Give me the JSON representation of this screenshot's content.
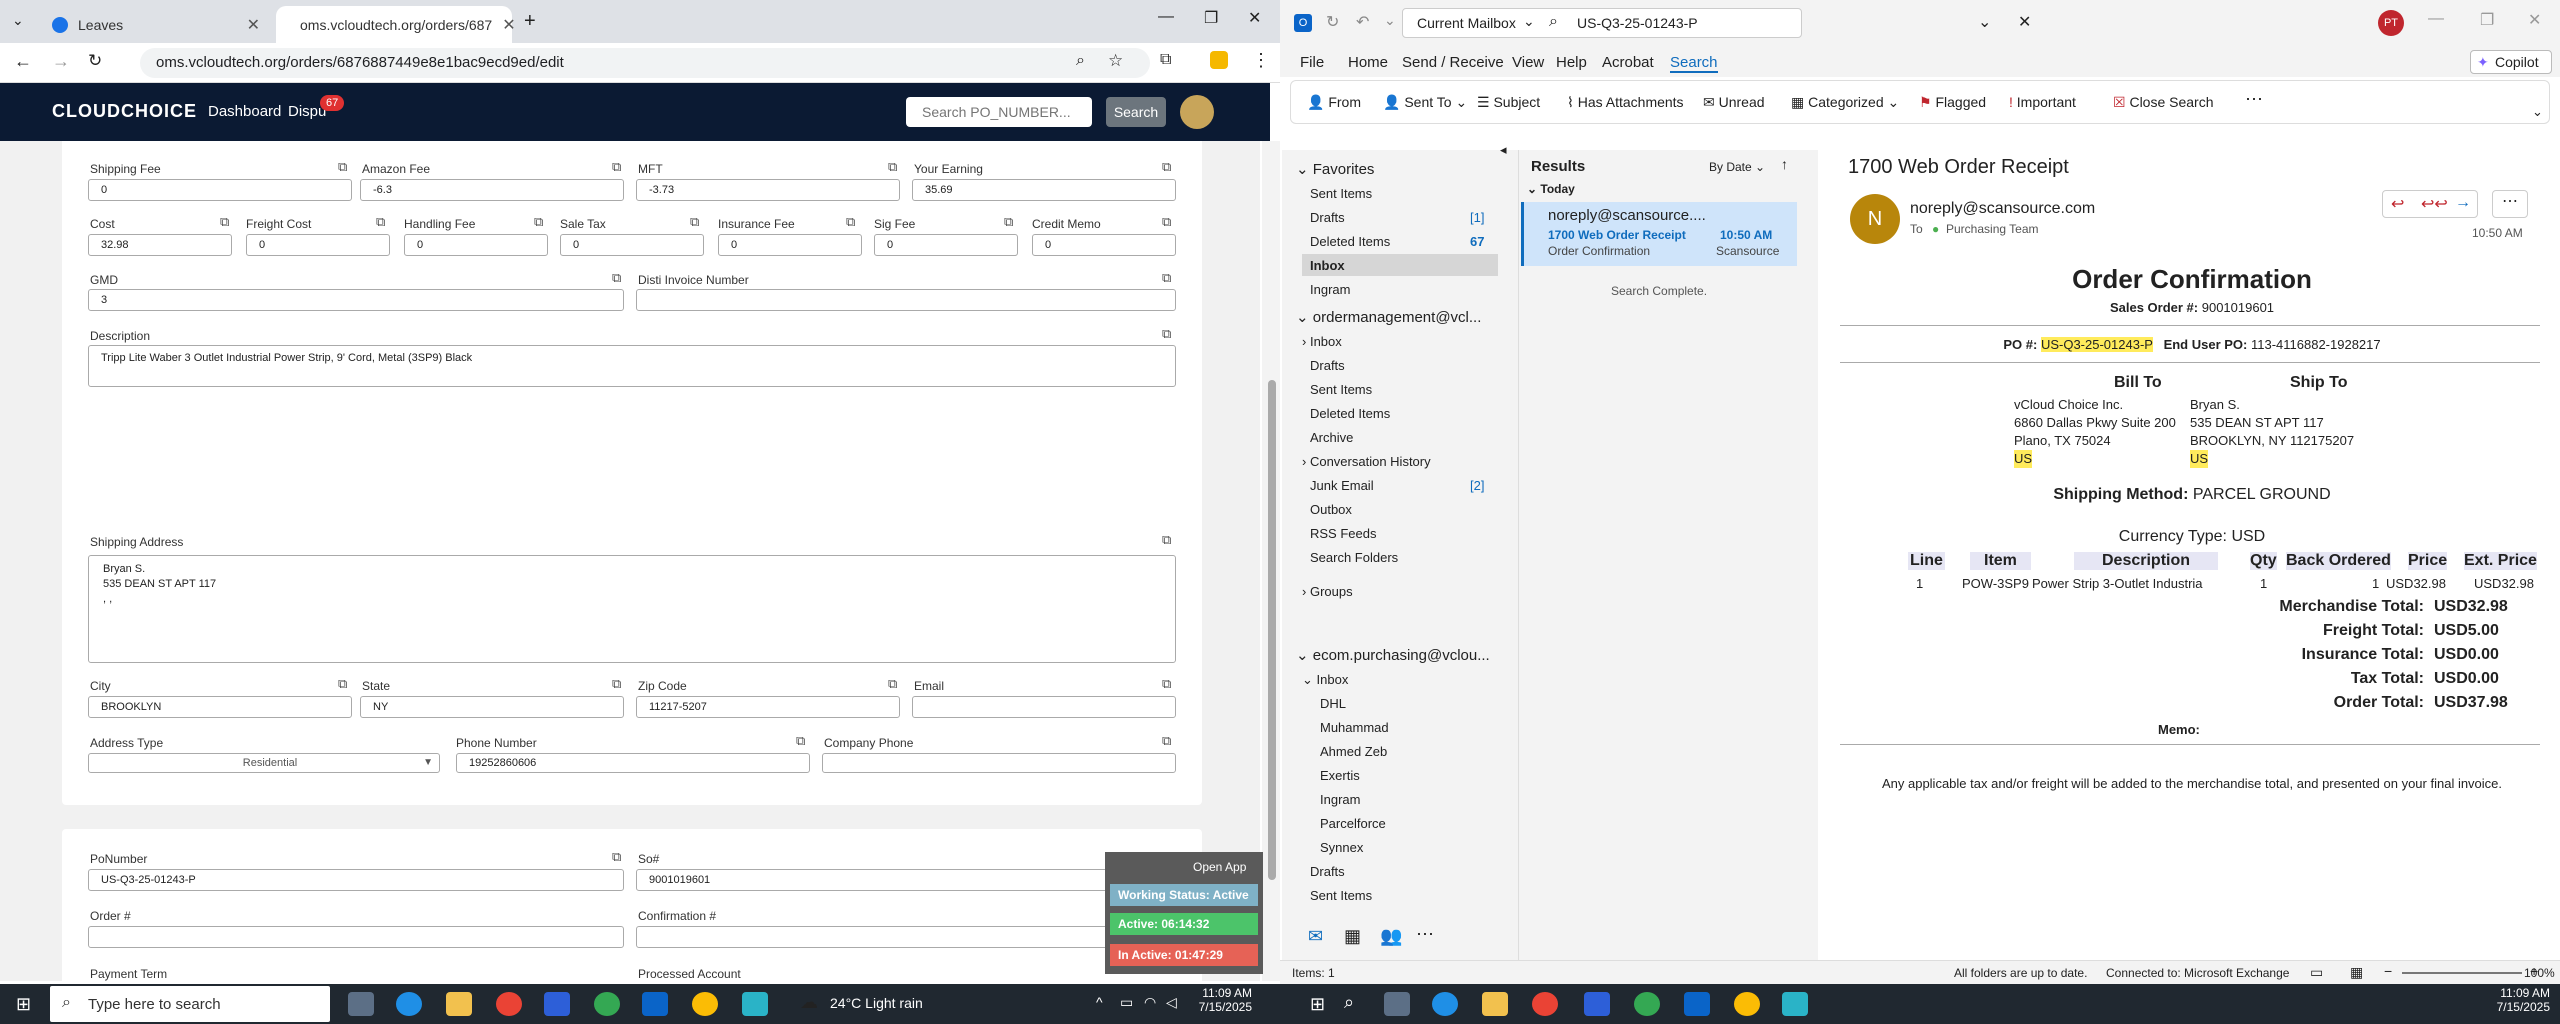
{
  "browser": {
    "tabs": [
      {
        "label": "Leaves"
      },
      {
        "label": "oms.vcloudtech.org/orders/687"
      }
    ],
    "url": "oms.vcloudtech.org/orders/6876887449e8e1bac9ecd9ed/edit"
  },
  "app": {
    "logo": "CLOUDCHOICE",
    "nav": {
      "dashboard": "Dashboard",
      "dispute": "Dispu",
      "badge": "67"
    },
    "search": {
      "placeholder": "Search PO_NUMBER...",
      "button": "Search"
    }
  },
  "form": {
    "row1": [
      {
        "label": "Shipping Fee",
        "value": "0"
      },
      {
        "label": "Amazon Fee",
        "value": "-6.3"
      },
      {
        "label": "MFT",
        "value": "-3.73"
      },
      {
        "label": "Your Earning",
        "value": "35.69"
      }
    ],
    "row2": [
      {
        "label": "Cost",
        "value": "32.98"
      },
      {
        "label": "Freight Cost",
        "value": "0"
      },
      {
        "label": "Handling Fee",
        "value": "0"
      },
      {
        "label": "Sale Tax",
        "value": "0"
      },
      {
        "label": "Insurance Fee",
        "value": "0"
      },
      {
        "label": "Sig Fee",
        "value": "0"
      },
      {
        "label": "Credit Memo",
        "value": "0"
      }
    ],
    "gmd": {
      "label": "GMD",
      "value": "3"
    },
    "disti": {
      "label": "Disti Invoice Number",
      "value": ""
    },
    "description": {
      "label": "Description",
      "value": "Tripp Lite Waber 3 Outlet Industrial Power Strip, 9' Cord, Metal (3SP9) Black"
    },
    "shipping_address": {
      "label": "Shipping Address",
      "line1": "Bryan S.",
      "line2": "535 DEAN ST APT 117",
      "line3": ", ,"
    },
    "city": {
      "label": "City",
      "value": "BROOKLYN"
    },
    "state": {
      "label": "State",
      "value": "NY"
    },
    "zip": {
      "label": "Zip Code",
      "value": "11217-5207"
    },
    "email": {
      "label": "Email",
      "value": ""
    },
    "address_type": {
      "label": "Address Type",
      "value": "Residential"
    },
    "phone": {
      "label": "Phone Number",
      "value": "19252860606"
    },
    "company_phone": {
      "label": "Company Phone",
      "value": ""
    },
    "po": {
      "label": "PoNumber",
      "value": "US-Q3-25-01243-P"
    },
    "so": {
      "label": "So#",
      "value": "9001019601"
    },
    "order": {
      "label": "Order #",
      "value": ""
    },
    "confirmation": {
      "label": "Confirmation #",
      "value": ""
    },
    "payment_term": {
      "label": "Payment Term"
    },
    "processed_account": {
      "label": "Processed Account"
    }
  },
  "widget": {
    "open_app": "Open App",
    "working": "Working Status: Active",
    "active": "Active: 06:14:32",
    "inactive": "In Active: 01:47:29"
  },
  "outlook": {
    "mailbox": "Current Mailbox",
    "search": "US-Q3-25-01243-P",
    "avatar": "PT",
    "copilot": "Copilot",
    "menu": [
      "File",
      "Home",
      "Send / Receive",
      "View",
      "Help",
      "Acrobat",
      "Search"
    ],
    "ribbon": [
      "From",
      "Sent To",
      "Subject",
      "Has Attachments",
      "Unread",
      "Categorized",
      "Flagged",
      "Important",
      "Close Search"
    ],
    "favorites": {
      "title": "Favorites",
      "items": [
        "Sent Items",
        "Drafts",
        "Deleted Items",
        "Inbox",
        "Ingram"
      ],
      "drafts_count": "[1]",
      "deleted_count": "67"
    },
    "account1": {
      "name": "ordermanagement@vcl...",
      "items": [
        "Inbox",
        "Drafts",
        "Sent Items",
        "Deleted Items",
        "Archive",
        "Conversation History",
        "Junk Email",
        "Outbox",
        "RSS Feeds",
        "Search Folders"
      ],
      "junk_count": "[2]"
    },
    "groups": "Groups",
    "account2": {
      "name": "ecom.purchasing@vclou...",
      "items": [
        "Inbox",
        "DHL",
        "Muhammad",
        "Ahmed Zeb",
        "Exertis",
        "Ingram",
        "Parcelforce",
        "Synnex",
        "Drafts",
        "Sent Items"
      ]
    },
    "results": {
      "title": "Results",
      "sort": "By Date",
      "group": "Today",
      "from": "noreply@scansource....",
      "subject": "1700 Web Order Receipt",
      "time": "10:50 AM",
      "preview": "Order Confirmation",
      "folder": "Scansource",
      "complete": "Search Complete."
    },
    "reading": {
      "subject": "1700 Web Order Receipt",
      "avatar": "N",
      "from": "noreply@scansource.com",
      "to": "To",
      "recipient": "Purchasing Team",
      "time": "10:50 AM"
    },
    "receipt": {
      "title": "Order Confirmation",
      "sales_order_label": "Sales Order #:",
      "sales_order": "9001019601",
      "po_label": "PO #:",
      "po": "US-Q3-25-01243-P",
      "enduser_label": "End User PO:",
      "enduser": "113-4116882-1928217",
      "bill_to": "Bill To",
      "ship_to": "Ship To",
      "bill": [
        "vCloud Choice Inc.",
        "6860 Dallas Pkwy Suite 200",
        "Plano, TX 75024",
        "US"
      ],
      "ship": [
        "Bryan S.",
        "535 DEAN ST APT 117",
        "BROOKLYN, NY 112175207",
        "US"
      ],
      "shipping_method_label": "Shipping Method:",
      "shipping_method": "PARCEL GROUND",
      "currency_label": "Currency Type:",
      "currency": "USD",
      "headers": [
        "Line",
        "Item",
        "Description",
        "Qty",
        "Back Ordered",
        "Price",
        "Ext. Price"
      ],
      "row": [
        "1",
        "POW-3SP9",
        "Power Strip 3-Outlet Industria",
        "1",
        "1",
        "USD32.98",
        "USD32.98"
      ],
      "totals": [
        {
          "label": "Merchandise Total:",
          "value": "USD32.98"
        },
        {
          "label": "Freight Total:",
          "value": "USD5.00"
        },
        {
          "label": "Insurance Total:",
          "value": "USD0.00"
        },
        {
          "label": "Tax Total:",
          "value": "USD0.00"
        },
        {
          "label": "Order Total:",
          "value": "USD37.98"
        }
      ],
      "memo": "Memo:",
      "footer": "Any applicable tax and/or freight will be added to the merchandise total, and presented on your final invoice."
    },
    "status": {
      "items": "Items: 1",
      "uptodate": "All folders are up to date.",
      "connected": "Connected to: Microsoft Exchange",
      "zoom": "100%"
    }
  },
  "taskbar": {
    "search": "Type here to search",
    "weather": "24°C Light rain",
    "time1": "11:09 AM",
    "date1": "7/15/2025",
    "time2": "11:09 AM",
    "date2": "7/15/2025"
  }
}
